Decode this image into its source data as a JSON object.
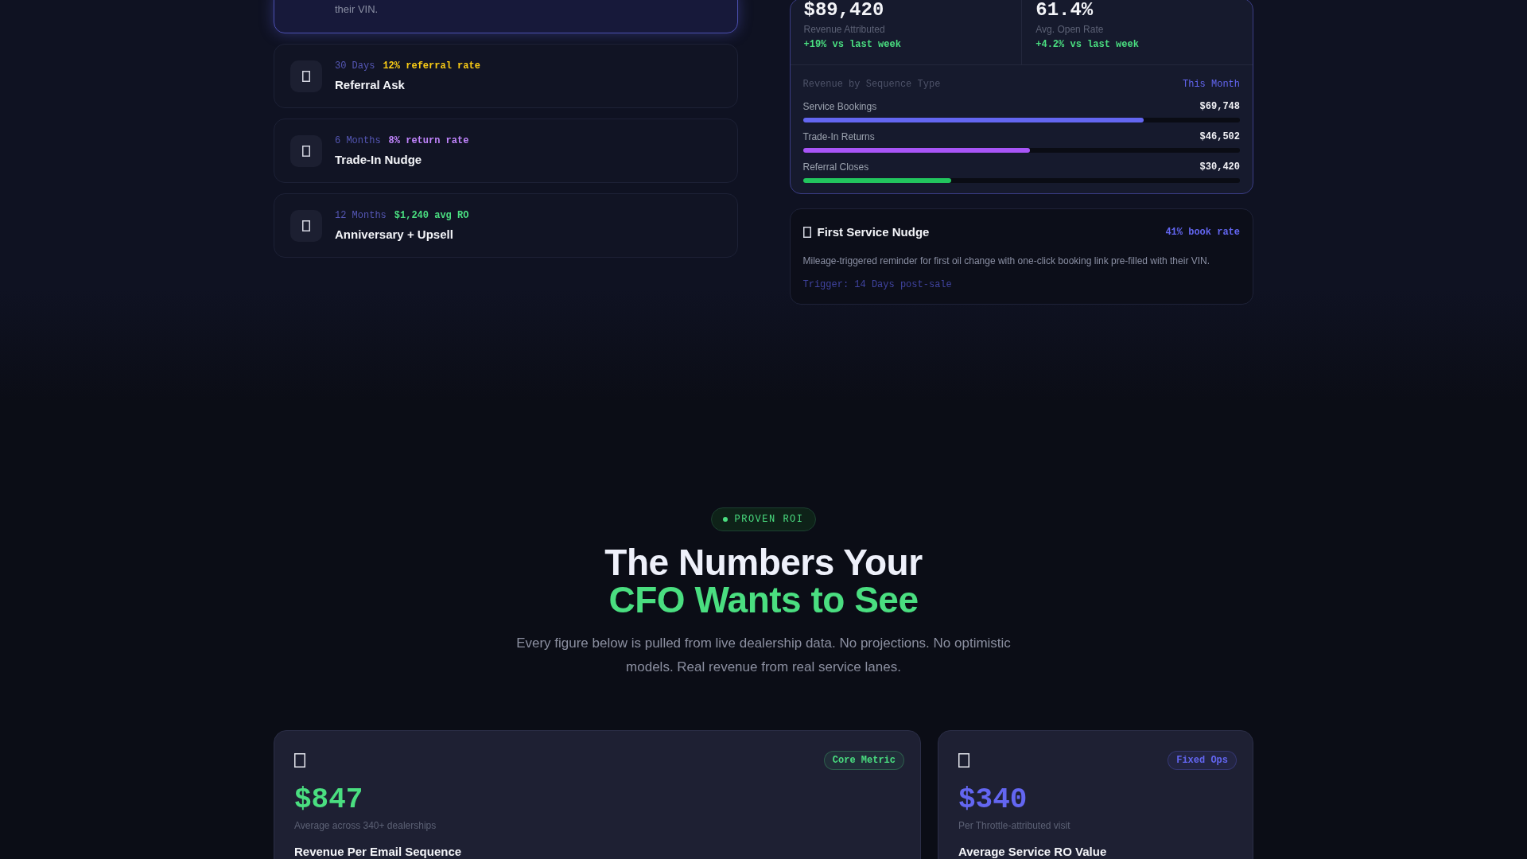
{
  "sequence_steps": [
    {
      "description": "their VIN.",
      "selected": true
    },
    {
      "timing": "30 Days",
      "metric": "12% referral rate",
      "color": "#facc15",
      "title": "Referral Ask",
      "selected": false
    },
    {
      "timing": "6 Months",
      "metric": "8% return rate",
      "color": "#c084fc",
      "title": "Trade-In Nudge",
      "selected": false
    },
    {
      "timing": "12 Months",
      "metric": "$1,240 avg RO",
      "color": "#4ade80",
      "title": "Anniversary + Upsell",
      "selected": false
    }
  ],
  "dashboard": {
    "stats": [
      {
        "value": "$89,420",
        "label": "Revenue Attributed",
        "change": "+19% vs last week"
      },
      {
        "value": "61.4%",
        "label": "Avg. Open Rate",
        "change": "+4.2% vs last week"
      }
    ],
    "breakdown": {
      "title": "Revenue by Sequence Type",
      "period": "This Month",
      "rows": [
        {
          "name": "Service Bookings",
          "amount": "$69,748",
          "level": 0.78,
          "color": "#6366f1"
        },
        {
          "name": "Trade-In Returns",
          "amount": "$46,502",
          "level": 0.52,
          "color": "#a855f7"
        },
        {
          "name": "Referral Closes",
          "amount": "$30,420",
          "level": 0.34,
          "color": "#22c55e"
        }
      ]
    }
  },
  "nudge_card": {
    "title": "First Service Nudge",
    "rate": "41% book rate",
    "description": "Mileage-triggered reminder for first oil change with one-click booking link pre-filled with their VIN.",
    "trigger": "Trigger: 14 Days post-sale"
  },
  "roi_section": {
    "badge": "PROVEN ROI",
    "heading_line_1": "The Numbers Your",
    "heading_line_2": "CFO Wants to See",
    "subtitle": "Every figure below is pulled from live dealership data. No projections. No optimistic models. Real revenue from real service lanes."
  },
  "metric_cards": [
    {
      "tag": "Core Metric",
      "value": "$847",
      "note": "Average across 340+ dealerships",
      "title": "Revenue Per Email Sequence",
      "color": "#4ade80"
    },
    {
      "tag": "Fixed Ops",
      "value": "$340",
      "note": "Per Throttle-attributed visit",
      "title": "Average Service RO Value",
      "color": "#6366f1"
    }
  ]
}
